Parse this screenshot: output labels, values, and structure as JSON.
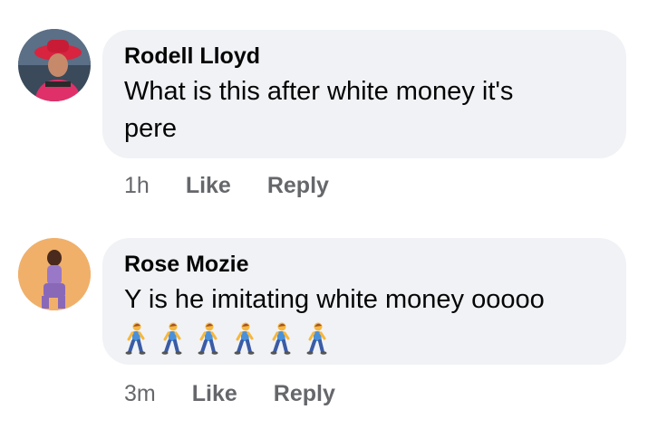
{
  "comments": [
    {
      "author": "Rodell Lloyd",
      "text_line1": "What is this after white money it's",
      "text_line2": "pere",
      "time": "1h",
      "like_label": "Like",
      "reply_label": "Reply",
      "avatar_icon": "avatar-woman-red-hat"
    },
    {
      "author": "Rose Mozie",
      "text_line1": "Y is he imitating white money ooooo",
      "emoji_icon": "person-walking-emoji",
      "emoji_count": 6,
      "time": "3m",
      "like_label": "Like",
      "reply_label": "Reply",
      "avatar_icon": "avatar-woman-purple-outfit"
    }
  ],
  "colors": {
    "bubble": "#f0f2f5",
    "text": "#050505",
    "meta": "#65676b"
  }
}
